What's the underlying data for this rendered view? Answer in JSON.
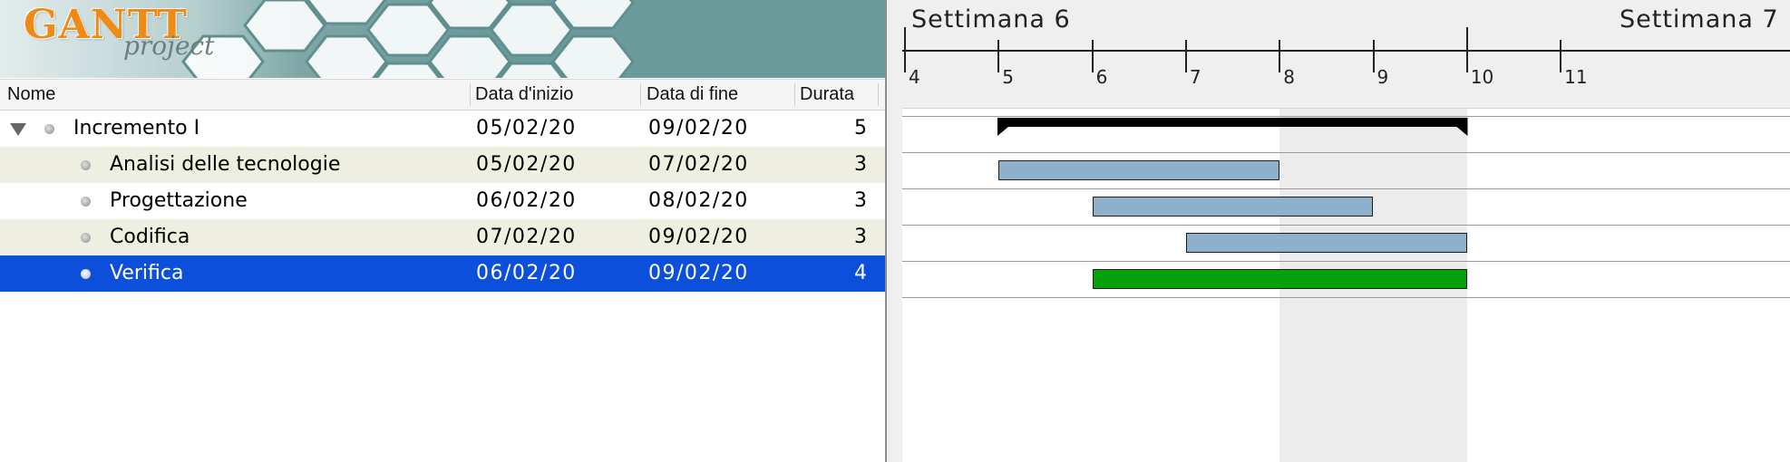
{
  "app": {
    "logo_main": "GANTT",
    "logo_sub": "project"
  },
  "table": {
    "columns": [
      "Nome",
      "Data d'inizio",
      "Data di fine",
      "Durata"
    ],
    "rows": [
      {
        "name": "Incremento I",
        "start": "05/02/20",
        "end": "09/02/20",
        "duration": "5",
        "type": "summary",
        "expanded": true
      },
      {
        "name": "Analisi delle tecnologie",
        "start": "05/02/20",
        "end": "07/02/20",
        "duration": "3",
        "type": "task"
      },
      {
        "name": "Progettazione",
        "start": "06/02/20",
        "end": "08/02/20",
        "duration": "3",
        "type": "task"
      },
      {
        "name": "Codifica",
        "start": "07/02/20",
        "end": "09/02/20",
        "duration": "3",
        "type": "task"
      },
      {
        "name": "Verifica",
        "start": "06/02/20",
        "end": "09/02/20",
        "duration": "4",
        "type": "task",
        "selected": true
      }
    ]
  },
  "timeline": {
    "weeks": [
      "Settimana  6",
      "Settimana  7"
    ],
    "days": [
      "4",
      "5",
      "6",
      "7",
      "8",
      "9",
      "10",
      "11"
    ],
    "weekend_days": [
      "8",
      "9"
    ]
  },
  "colors": {
    "selection": "#0c4fdb",
    "task_bar": "#8eb0ca",
    "selected_bar": "#06a10a",
    "alt_row": "#eeefe0",
    "banner": "#6a9a9a",
    "logo": "#f08a17"
  }
}
